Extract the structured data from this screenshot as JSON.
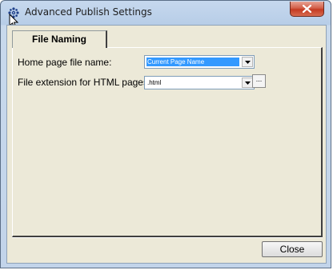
{
  "window": {
    "title": "Advanced Publish Settings",
    "app_icon": "gear-icon",
    "close_icon": "close-icon"
  },
  "tabs": [
    {
      "label": "File Naming",
      "selected": true
    }
  ],
  "form": {
    "home_page_label": "Home page file name:",
    "home_page_value": "Current Page Name",
    "extension_label": "File extension for HTML pages:",
    "extension_value": ".html",
    "browse_label": "..."
  },
  "buttons": {
    "close_label": "Close"
  },
  "colors": {
    "selection": "#3399ff",
    "dialog_bg": "#ece9d8",
    "close_x": "#c43b22"
  }
}
